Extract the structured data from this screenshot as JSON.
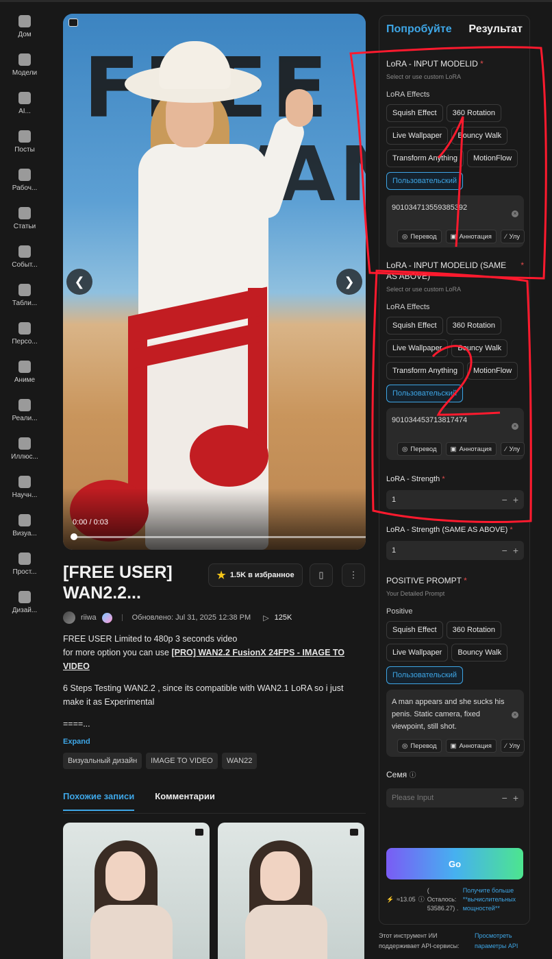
{
  "sidebar": {
    "items": [
      {
        "label": "Дом",
        "icon": "home-icon"
      },
      {
        "label": "Модели",
        "icon": "cube-icon"
      },
      {
        "label": "AI...",
        "icon": "ai-tools-icon"
      },
      {
        "label": "Посты",
        "icon": "posts-icon"
      },
      {
        "label": "Рабоч...",
        "icon": "workflow-icon"
      },
      {
        "label": "Статьи",
        "icon": "article-icon"
      },
      {
        "label": "Событ...",
        "icon": "flag-icon"
      },
      {
        "label": "Табли...",
        "icon": "trophy-icon"
      },
      {
        "label": "Персо...",
        "icon": "person-icon"
      },
      {
        "label": "Аниме",
        "icon": "anime-icon"
      },
      {
        "label": "Реали...",
        "icon": "camera-icon"
      },
      {
        "label": "Иллюс...",
        "icon": "palette-icon"
      },
      {
        "label": "Научн...",
        "icon": "ufo-icon"
      },
      {
        "label": "Визуа...",
        "icon": "visual-icon"
      },
      {
        "label": "Прост...",
        "icon": "column-icon"
      },
      {
        "label": "Дизай...",
        "icon": "gamepad-icon"
      }
    ]
  },
  "media": {
    "overlay_text_1": "FREE",
    "overlay_text_2": "WAN",
    "prev_glyph": "❮",
    "next_glyph": "❯",
    "time": "0:00 / 0:03",
    "progress": 0.0
  },
  "post": {
    "title": "[FREE USER] WAN2.2...",
    "favorites_label": "1.5K  в избранное",
    "author": "riiwa",
    "updated": "Обновлено: Jul 31, 2025 12:38 PM",
    "views": "125K",
    "desc_line1": "FREE USER Limited to 480p 3 seconds video",
    "desc_line2_prefix": "for more option you can use ",
    "desc_link": "[PRO] WAN2.2 FusionX 24FPS - IMAGE TO VIDEO",
    "desc_para2": "6 Steps Testing WAN2.2 , since its compatible with WAN2.1 LoRA so i just make it as Experimental",
    "desc_para3": "====...",
    "expand": "Expand",
    "tags": [
      "Визуальный дизайн",
      "IMAGE TO VIDEO",
      "WAN22"
    ],
    "tabs": [
      "Похожие записи",
      "Комментарии"
    ]
  },
  "panel": {
    "tabs": [
      "Попробуйте",
      "Результат"
    ],
    "lora1": {
      "title": "LoRA - INPUT MODELID",
      "sub": "Select or use custom LoRA",
      "effects_label": "LoRA Effects",
      "chips": [
        "Squish Effect",
        "360 Rotation",
        "Live Wallpaper",
        "Bouncy Walk",
        "Transform Anything",
        "MotionFlow"
      ],
      "custom": "Пользовательский",
      "value": "901034713559385392"
    },
    "lora2": {
      "title": "LoRA - INPUT MODELID (SAME AS ABOVE)",
      "sub": "Select or use custom LoRA",
      "effects_label": "LoRA Effects",
      "chips": [
        "Squish Effect",
        "360 Rotation",
        "Live Wallpaper",
        "Bouncy Walk",
        "Transform Anything",
        "MotionFlow"
      ],
      "custom": "Пользовательский",
      "value": "901034453713817474"
    },
    "actions": [
      "Перевод",
      "Аннотация",
      "Улу"
    ],
    "strength1": {
      "label": "LoRA - Strength",
      "value": "1"
    },
    "strength2": {
      "label": "LoRA - Strength (SAME AS ABOVE)",
      "value": "1"
    },
    "prompt": {
      "title": "POSITIVE PROMPT",
      "sub": "Your Detailed Prompt",
      "label": "Positive",
      "chips": [
        "Squish Effect",
        "360 Rotation",
        "Live Wallpaper",
        "Bouncy Walk"
      ],
      "custom": "Пользовательский",
      "value": "A man appears and she sucks his penis. Static camera, fixed viewpoint, still shot."
    },
    "seed": {
      "label": "Семя",
      "placeholder": "Please Input"
    },
    "go": "Go",
    "credits": "≈13.05",
    "remaining": "( Осталось: 53586.27) .",
    "more_link": "Получите больше **вычислительных мощностей**"
  },
  "footer": {
    "text": "Этот инструмент ИИ поддерживает API-сервисы:",
    "link": "Просмотреть параметры API"
  },
  "annotations": {
    "label_1": "1",
    "label_2": "2",
    "color": "#ff1a2e"
  },
  "colors": {
    "accent": "#3ea6e6",
    "bg": "#181818",
    "required": "#e24c4c"
  }
}
